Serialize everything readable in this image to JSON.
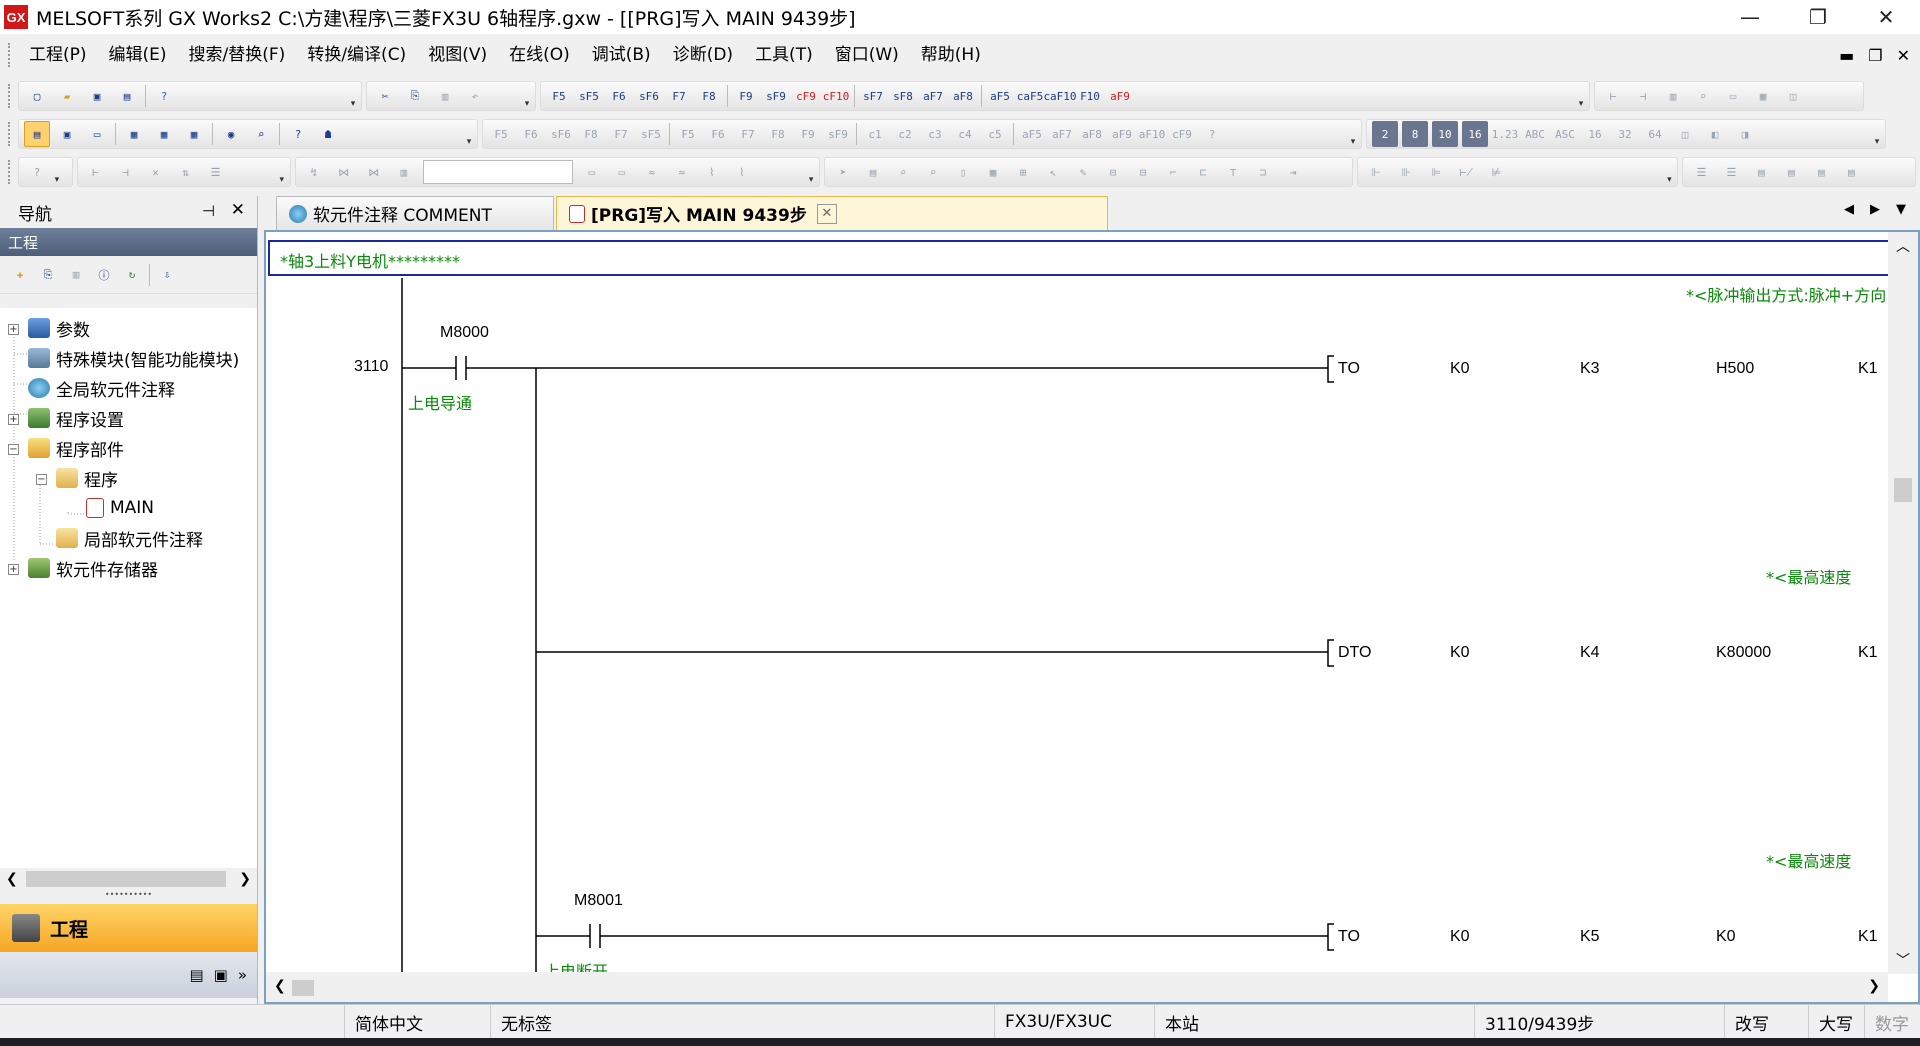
{
  "window": {
    "title": "MELSOFT系列 GX Works2 C:\\方建\\程序\\三菱FX3U 6轴程序.gxw - [[PRG]写入 MAIN 9439步]",
    "app_icon_text": "GX",
    "minimize": "—",
    "restore": "❐",
    "close": "✕"
  },
  "menu": {
    "items": [
      "工程(P)",
      "编辑(E)",
      "搜索/替换(F)",
      "转换/编译(C)",
      "视图(V)",
      "在线(O)",
      "调试(B)",
      "诊断(D)",
      "工具(T)",
      "窗口(W)",
      "帮助(H)"
    ],
    "mdi_min": "▬",
    "mdi_restore": "❐",
    "mdi_close": "✕"
  },
  "toolbar1": {
    "ladder_keys": [
      "F5",
      "sF5",
      "F6",
      "sF6",
      "F7",
      "F8",
      "F9",
      "sF9",
      "cF9",
      "cF10",
      "sF7",
      "sF8",
      "aF7",
      "aF8",
      "aF5",
      "caF5",
      "caF10",
      "F10",
      "aF9"
    ]
  },
  "toolbar2": {
    "keys": [
      "F5",
      "F6",
      "sF6",
      "F8",
      "F7",
      "sF5",
      "F5",
      "F6",
      "F7",
      "F8",
      "F9",
      "sF9",
      "c1",
      "c2",
      "c3",
      "c4",
      "c5",
      "aF5",
      "aF7",
      "aF8",
      "aF9",
      "aF10",
      "cF9"
    ],
    "numeric": [
      "2",
      "8",
      "10",
      "16",
      "1.23",
      "ABC",
      "ASC",
      "16",
      "32",
      "64"
    ]
  },
  "navigation": {
    "title": "导航",
    "pin": "⊣",
    "close": "✕",
    "section": "工程",
    "tree": [
      {
        "label": "参数",
        "expander": "+"
      },
      {
        "label": "特殊模块(智能功能模块)",
        "expander": ""
      },
      {
        "label": "全局软元件注释",
        "expander": ""
      },
      {
        "label": "程序设置",
        "expander": "+"
      },
      {
        "label": "程序部件",
        "expander": "−"
      },
      {
        "label": "程序",
        "expander": "−"
      },
      {
        "label": "MAIN",
        "expander": ""
      },
      {
        "label": "局部软元件注释",
        "expander": ""
      },
      {
        "label": "软元件存储器",
        "expander": "+"
      }
    ],
    "project_tab": "工程"
  },
  "tabs": [
    {
      "label": "软元件注释 COMMENT",
      "active": false
    },
    {
      "label": "[PRG]写入 MAIN 9439步",
      "active": true,
      "close": "✕"
    }
  ],
  "editor": {
    "comment_line": "*轴3上料Y电机*********",
    "step": "3110",
    "contacts": [
      {
        "device": "M8000",
        "comment": "上电导通"
      },
      {
        "device": "M8001",
        "comment": "上电断开"
      }
    ],
    "instructions": [
      {
        "op": "TO",
        "args": [
          "K0",
          "K3",
          "H500",
          "K1"
        ],
        "note": "*<脉冲输出方式:脉冲+方向"
      },
      {
        "op": "DTO",
        "args": [
          "K0",
          "K4",
          "K80000",
          "K1"
        ],
        "note": "*<最高速度"
      },
      {
        "op": "TO",
        "args": [
          "K0",
          "K5",
          "K0",
          "K1"
        ],
        "note": "*<最高速度"
      }
    ]
  },
  "statusbar": {
    "language": "简体中文",
    "label": "无标签",
    "plc": "FX3U/FX3UC",
    "station": "本站",
    "steps": "3110/9439步",
    "mode": "改写",
    "caps": "大写",
    "num": "数字"
  }
}
